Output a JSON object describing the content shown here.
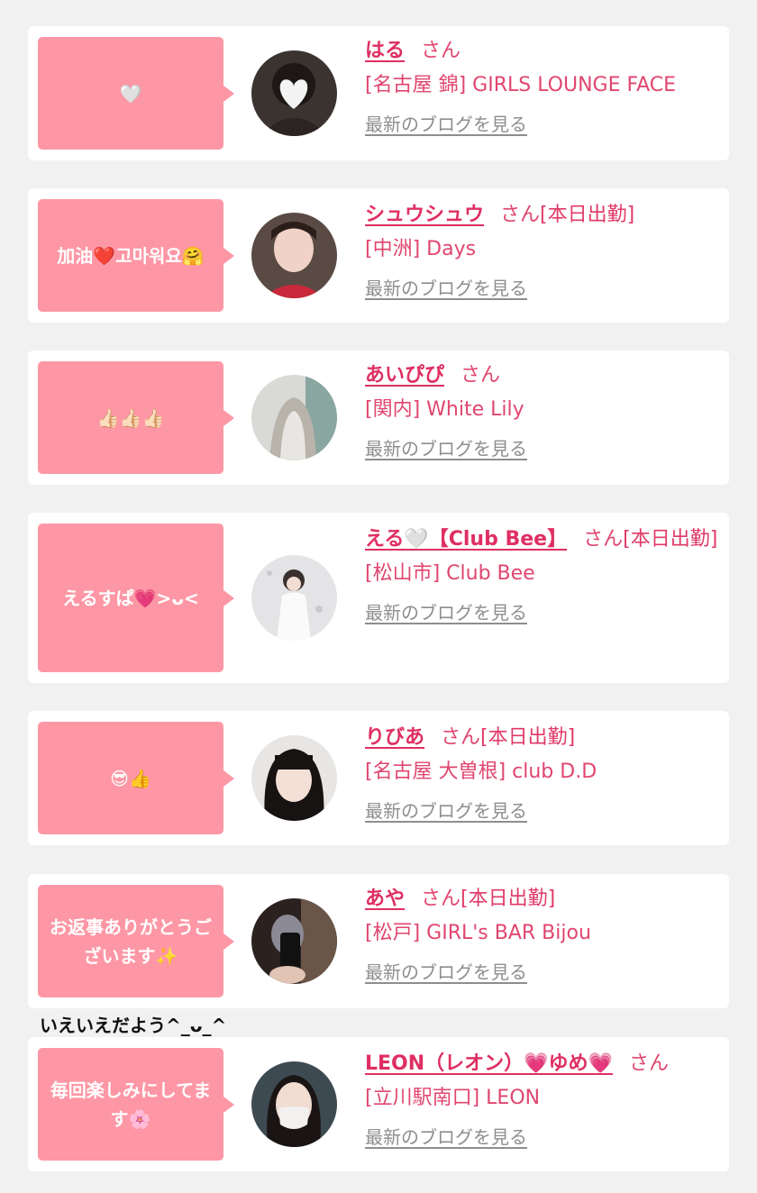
{
  "items": [
    {
      "message": "🤍",
      "name": "はる",
      "honorific": "さん",
      "status": "",
      "shop": "[名古屋 錦] GIRLS LOUNGE FACE",
      "blog_link": "最新のブログを見る"
    },
    {
      "message": "加油❤️고마워요🤗",
      "name": "シュウシュウ",
      "honorific": "さん",
      "status": "[本日出勤]",
      "shop": "[中洲] Days",
      "blog_link": "最新のブログを見る"
    },
    {
      "message": "👍🏻👍🏻👍🏻",
      "name": "あいぴぴ",
      "honorific": "さん",
      "status": "",
      "shop": "[関内] White Lily",
      "blog_link": "最新のブログを見る"
    },
    {
      "message": "えるすぱ💗>ᴗ<",
      "name": "える🤍【Club Bee】",
      "honorific": "さん",
      "status": "[本日出勤]",
      "shop": "[松山市] Club Bee",
      "blog_link": "最新のブログを見る"
    },
    {
      "message": "😎👍",
      "name": "りびあ",
      "honorific": "さん",
      "status": "[本日出勤]",
      "shop": "[名古屋 大曽根] club D.D",
      "blog_link": "最新のブログを見る"
    },
    {
      "message": "お返事ありがとうございます✨",
      "name": "あや",
      "honorific": "さん",
      "status": "[本日出勤]",
      "shop": "[松戸] GIRL's BAR Bijou",
      "blog_link": "最新のブログを見る"
    },
    {
      "message": "毎回楽しみにしてます🌸",
      "name": "LEON（レオン）💗ゆめ💗",
      "honorific": "さん",
      "status": "",
      "shop": "[立川駅南口] LEON",
      "blog_link": "最新のブログを見る"
    }
  ],
  "caption": "いえいえだよう^_ᴗ_^",
  "colors": {
    "bubble": "#fe97a5",
    "name": "#df2f62",
    "text": "#e0466f",
    "link": "#8e8e8e",
    "background": "#f1f1f1"
  }
}
